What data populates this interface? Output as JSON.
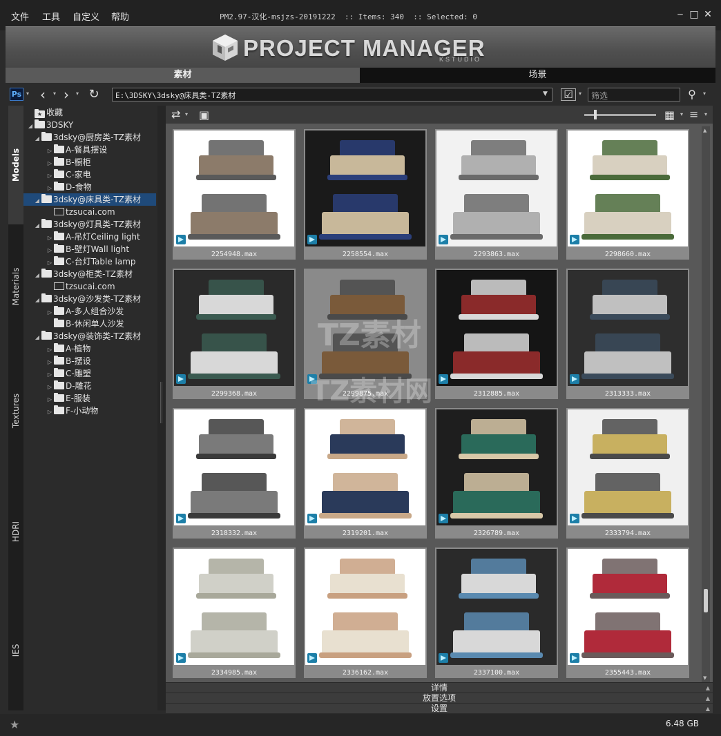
{
  "menu": {
    "items": [
      "文件",
      "工具",
      "自定义",
      "帮助"
    ],
    "title": "PM2.97-汉化-msjzs-20191222  :: Items: 340  :: Selected: 0"
  },
  "banner": {
    "logo_text": "PROJECT MANAGER",
    "logo_sub": "KSTUDIO"
  },
  "main_tabs": {
    "material": "素材",
    "scene": "场景"
  },
  "toolbar": {
    "ps_label": "Ps",
    "path": "E:\\3DSKY\\3dsky@床具类-TZ素材",
    "filter_placeholder": "筛选"
  },
  "side_tabs": [
    "Models",
    "Materials",
    "Textures",
    "HDRI",
    "IES"
  ],
  "tree": [
    {
      "label": "收藏",
      "level": 0,
      "arrow": "",
      "icon": "star-folder-icon"
    },
    {
      "label": "3DSKY",
      "level": 0,
      "arrow": "▲",
      "icon": "folder-icon"
    },
    {
      "label": "3dsky@厨房类-TZ素材",
      "level": 1,
      "arrow": "▲",
      "icon": "folder-icon"
    },
    {
      "label": "A-餐具摆设",
      "level": 2,
      "arrow": "▶",
      "icon": "folder-icon"
    },
    {
      "label": "B-橱柜",
      "level": 2,
      "arrow": "▶",
      "icon": "folder-icon"
    },
    {
      "label": "C-家电",
      "level": 2,
      "arrow": "▶",
      "icon": "folder-icon"
    },
    {
      "label": "D-食物",
      "level": 2,
      "arrow": "▶",
      "icon": "folder-icon"
    },
    {
      "label": "3dsky@床具类-TZ素材",
      "level": 1,
      "arrow": "▲",
      "icon": "folder-icon",
      "selected": true
    },
    {
      "label": "tzsucai.com",
      "level": 2,
      "arrow": "",
      "icon": "file-icon"
    },
    {
      "label": "3dsky@灯具类-TZ素材",
      "level": 1,
      "arrow": "▲",
      "icon": "folder-icon"
    },
    {
      "label": "A-吊灯Ceiling light",
      "level": 2,
      "arrow": "▶",
      "icon": "folder-icon"
    },
    {
      "label": "B-壁灯Wall light",
      "level": 2,
      "arrow": "▶",
      "icon": "folder-icon"
    },
    {
      "label": "C-台灯Table lamp",
      "level": 2,
      "arrow": "▶",
      "icon": "folder-icon"
    },
    {
      "label": "3dsky@柜类-TZ素材",
      "level": 1,
      "arrow": "▲",
      "icon": "folder-icon"
    },
    {
      "label": "tzsucai.com",
      "level": 2,
      "arrow": "",
      "icon": "file-icon"
    },
    {
      "label": "3dsky@沙发类-TZ素材",
      "level": 1,
      "arrow": "▲",
      "icon": "folder-icon"
    },
    {
      "label": "A-多人组合沙发",
      "level": 2,
      "arrow": "▶",
      "icon": "folder-icon"
    },
    {
      "label": "B-休闲单人沙发",
      "level": 2,
      "arrow": "",
      "icon": "folder-icon"
    },
    {
      "label": "3dsky@装饰类-TZ素材",
      "level": 1,
      "arrow": "▲",
      "icon": "folder-icon"
    },
    {
      "label": "A-植物",
      "level": 2,
      "arrow": "▶",
      "icon": "folder-icon"
    },
    {
      "label": "B-摆设",
      "level": 2,
      "arrow": "▶",
      "icon": "folder-icon"
    },
    {
      "label": "C-雕塑",
      "level": 2,
      "arrow": "▶",
      "icon": "folder-icon"
    },
    {
      "label": "D-雕花",
      "level": 2,
      "arrow": "▶",
      "icon": "folder-icon"
    },
    {
      "label": "E-服装",
      "level": 2,
      "arrow": "▶",
      "icon": "folder-icon"
    },
    {
      "label": "F-小动物",
      "level": 2,
      "arrow": "▶",
      "icon": "folder-icon"
    }
  ],
  "thumbnails": [
    {
      "name": "2254948.max",
      "bg": "#ffffff",
      "bed": "#5a5a5a",
      "accent": "#8c7b6a"
    },
    {
      "name": "2258554.max",
      "bg": "#1a1a1a",
      "bed": "#2b3f7a",
      "accent": "#c8b89a"
    },
    {
      "name": "2293863.max",
      "bg": "#f2f2f2",
      "bed": "#6a6a6a",
      "accent": "#b0b0b0"
    },
    {
      "name": "2298660.max",
      "bg": "#ffffff",
      "bed": "#4a6a3a",
      "accent": "#d8d0c0"
    },
    {
      "name": "2299368.max",
      "bg": "#2a2a2a",
      "bed": "#3a5a50",
      "accent": "#d8d8d8"
    },
    {
      "name": "2299875.max",
      "bg": "#8a8a8a",
      "bed": "#4a4a4a",
      "accent": "#7a5a3a"
    },
    {
      "name": "2312885.max",
      "bg": "#151515",
      "bed": "#d8d8d8",
      "accent": "#8a2a2a"
    },
    {
      "name": "2313333.max",
      "bg": "#2e2e2e",
      "bed": "#3a4a5a",
      "accent": "#c0c0c0"
    },
    {
      "name": "2318332.max",
      "bg": "#ffffff",
      "bed": "#3a3a3a",
      "accent": "#7a7a7a"
    },
    {
      "name": "2319201.max",
      "bg": "#ffffff",
      "bed": "#c8a888",
      "accent": "#2a3a5a"
    },
    {
      "name": "2326789.max",
      "bg": "#1e1e1e",
      "bed": "#d8c8a8",
      "accent": "#2a6a5a"
    },
    {
      "name": "2333794.max",
      "bg": "#f0f0f0",
      "bed": "#4a4a4a",
      "accent": "#c8b060"
    },
    {
      "name": "2334985.max",
      "bg": "#ffffff",
      "bed": "#a8a89a",
      "accent": "#d0d0c8"
    },
    {
      "name": "2336162.max",
      "bg": "#ffffff",
      "bed": "#c8a080",
      "accent": "#e8e0d0"
    },
    {
      "name": "2337100.max",
      "bg": "#2a2a2a",
      "bed": "#5a8ab0",
      "accent": "#d8d8d8"
    },
    {
      "name": "2355443.max",
      "bg": "#ffffff",
      "bed": "#6a5a5a",
      "accent": "#b02a3a"
    }
  ],
  "panels": [
    "详情",
    "放置选项",
    "设置"
  ],
  "status": {
    "disk_size": "6.48 GB"
  },
  "watermark": {
    "line1": "TZ素材",
    "line2": "TZ素材网"
  }
}
